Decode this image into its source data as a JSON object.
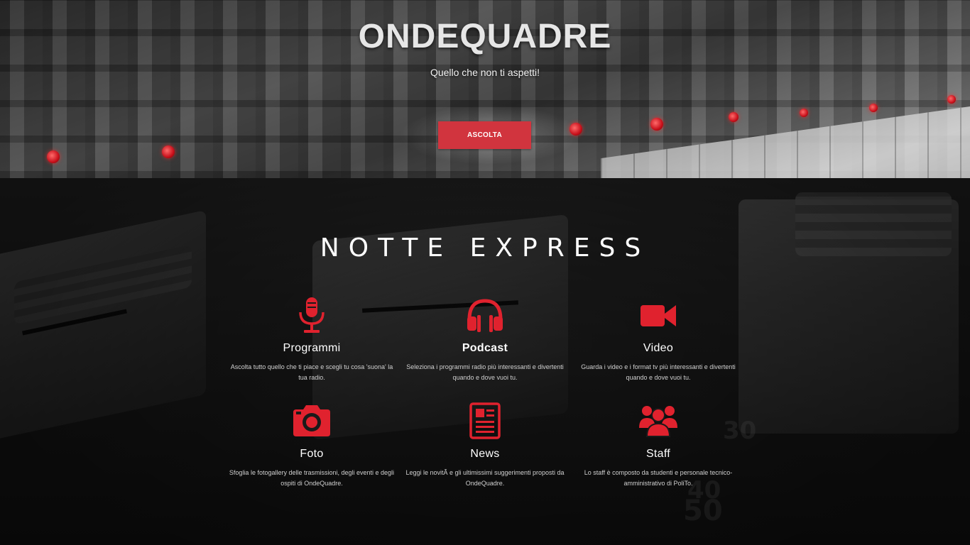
{
  "hero": {
    "title": "ONDEQUADRE",
    "subtitle": "Quello che non ti aspetti!",
    "button_label": "ASCOLTA"
  },
  "main": {
    "section_title": "NOTTE EXPRESS",
    "features": [
      {
        "title": "Programmi",
        "description": "Ascolta tutto quello che ti piace e scegli tu cosa 'suona' la tua radio.",
        "icon": "microphone-icon"
      },
      {
        "title": "Podcast",
        "description": "Seleziona i programmi radio più interessanti e divertenti quando e dove vuoi tu.",
        "icon": "headphones-icon"
      },
      {
        "title": "Video",
        "description": "Guarda i video e i format tv più interessanti e divertenti quando e dove vuoi tu.",
        "icon": "video-camera-icon"
      },
      {
        "title": "Foto",
        "description": "Sfoglia le fotogallery delle trasmissioni, degli eventi e degli ospiti di OndeQuadre.",
        "icon": "camera-icon"
      },
      {
        "title": "News",
        "description": "Leggi le novitÃ  e gli ultimissimi suggerimenti proposti da OndeQuadre.",
        "icon": "newspaper-icon"
      },
      {
        "title": "Staff",
        "description": "Lo staff è composto da studenti e personale tecnico-amministrativo di PoliTo.",
        "icon": "group-icon"
      }
    ]
  },
  "colors": {
    "accent": "#d1343e",
    "icon_red": "#e0222e"
  }
}
